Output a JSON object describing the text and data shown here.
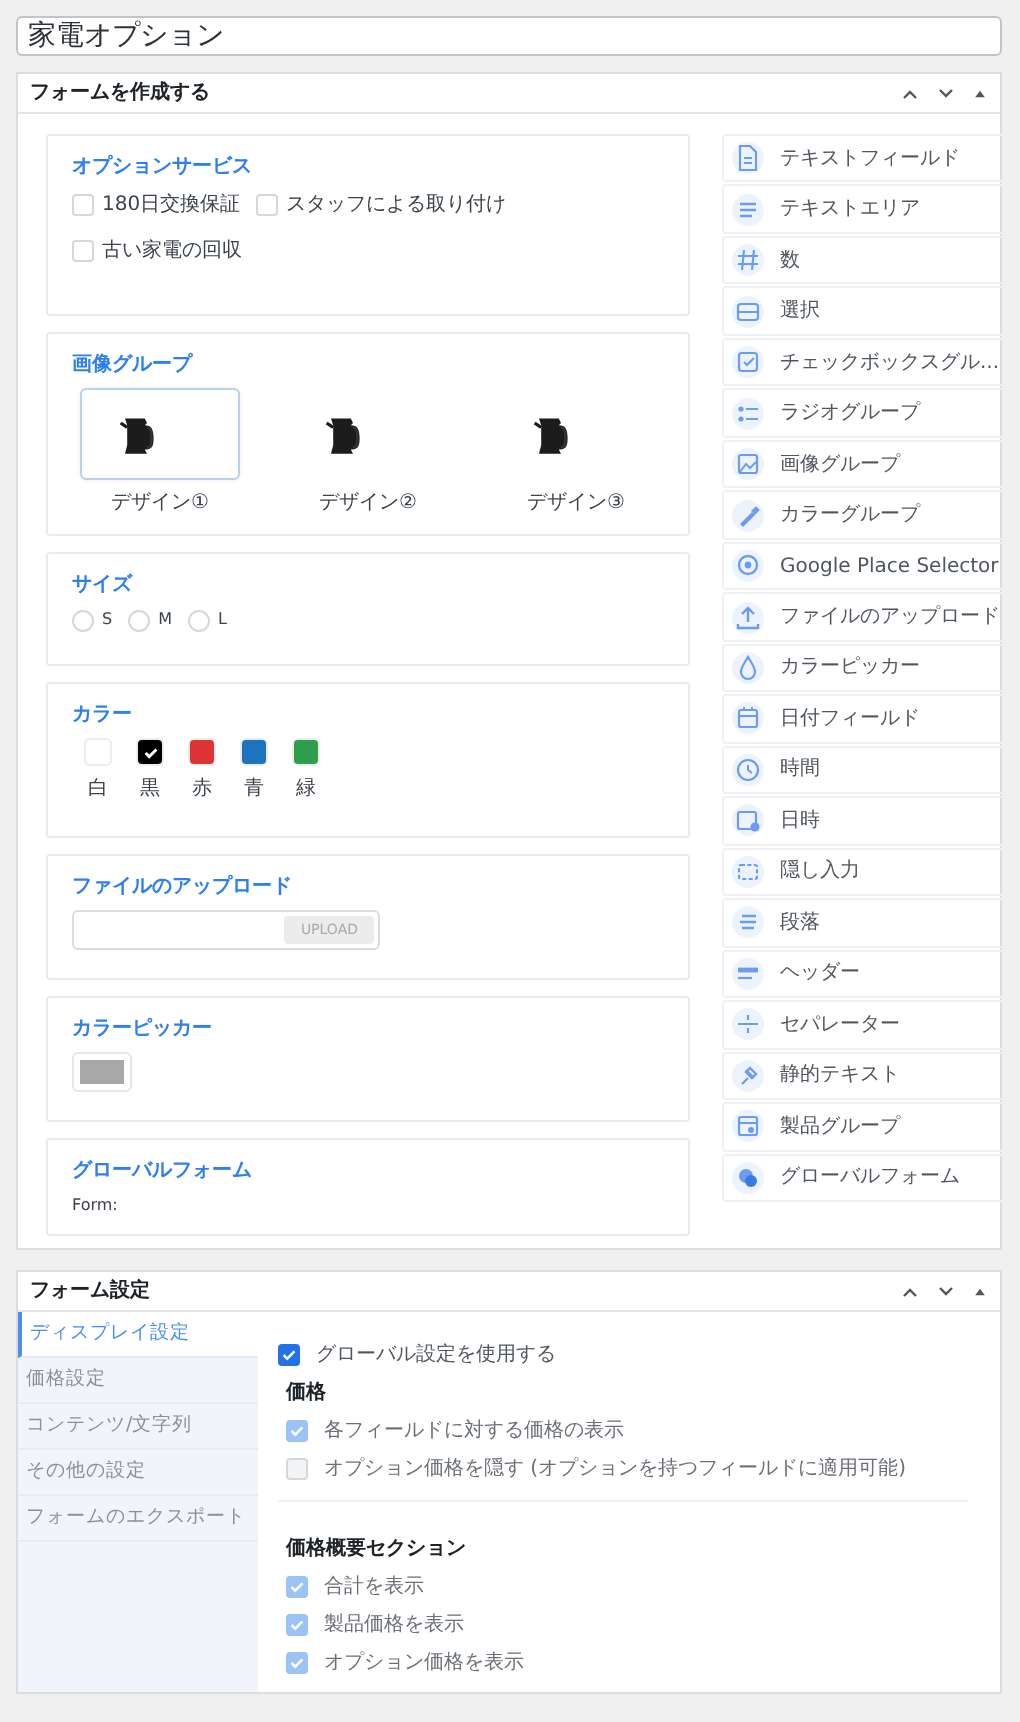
{
  "title_field": {
    "value": "家電オプション"
  },
  "builder": {
    "title": "フォームを作成する",
    "sections": [
      {
        "kind": "checkboxes",
        "label": "オプションサービス",
        "options": [
          {
            "label": "180日交換保証",
            "checked": false
          },
          {
            "label": "スタッフによる取り付け",
            "checked": false
          },
          {
            "label": "古い家電の回収",
            "checked": false
          }
        ]
      },
      {
        "kind": "images",
        "label": "画像グループ",
        "options": [
          {
            "label": "デザイン①",
            "selected": true
          },
          {
            "label": "デザイン②",
            "selected": false
          },
          {
            "label": "デザイン③",
            "selected": false
          }
        ]
      },
      {
        "kind": "radios",
        "label": "サイズ",
        "options": [
          {
            "label": "S",
            "selected": false
          },
          {
            "label": "M",
            "selected": false
          },
          {
            "label": "L",
            "selected": false
          }
        ]
      },
      {
        "kind": "swatches",
        "label": "カラー",
        "options": [
          {
            "label": "白",
            "color": "#ffffff",
            "selected": false
          },
          {
            "label": "黒",
            "color": "#000000",
            "selected": true
          },
          {
            "label": "赤",
            "color": "#dd3333",
            "selected": false
          },
          {
            "label": "青",
            "color": "#1e73be",
            "selected": false
          },
          {
            "label": "緑",
            "color": "#2e9e4a",
            "selected": false
          }
        ]
      },
      {
        "kind": "upload",
        "label": "ファイルのアップロード",
        "button": "UPLOAD"
      },
      {
        "kind": "colorpicker",
        "label": "カラーピッカー"
      },
      {
        "kind": "global",
        "label": "グローバルフォーム",
        "text": "Form:"
      }
    ],
    "fields": [
      {
        "label": "テキストフィールド"
      },
      {
        "label": "テキストエリア"
      },
      {
        "label": "数"
      },
      {
        "label": "選択"
      },
      {
        "label": "チェックボックスグル..."
      },
      {
        "label": "ラジオグループ"
      },
      {
        "label": "画像グループ"
      },
      {
        "label": "カラーグループ"
      },
      {
        "label": "Google Place Selector"
      },
      {
        "label": "ファイルのアップロード"
      },
      {
        "label": "カラーピッカー"
      },
      {
        "label": "日付フィールド"
      },
      {
        "label": "時間"
      },
      {
        "label": "日時"
      },
      {
        "label": "隠し入力"
      },
      {
        "label": "段落"
      },
      {
        "label": "ヘッダー"
      },
      {
        "label": "セパレーター"
      },
      {
        "label": "静的テキスト"
      },
      {
        "label": "製品グループ"
      },
      {
        "label": "グローバルフォーム"
      }
    ]
  },
  "settings": {
    "title": "フォーム設定",
    "tabs": [
      {
        "label": "ディスプレイ設定",
        "selected": true
      },
      {
        "label": "価格設定",
        "selected": false
      },
      {
        "label": "コンテンツ/文字列",
        "selected": false
      },
      {
        "label": "その他の設定",
        "selected": false
      },
      {
        "label": "フォームのエクスポート",
        "selected": false
      }
    ],
    "global": {
      "label": "グローバル設定を使用する",
      "checked": true,
      "disabled": false
    },
    "groups": [
      {
        "heading": "価格",
        "options": [
          {
            "label": "各フィールドに対する価格の表示",
            "checked": true,
            "disabled": true
          },
          {
            "label": "オプション価格を隠す (オプションを持つフィールドに適用可能)",
            "checked": false,
            "disabled": true
          }
        ]
      },
      {
        "heading": "価格概要セクション",
        "options": [
          {
            "label": "合計を表示",
            "checked": true,
            "disabled": true
          },
          {
            "label": "製品価格を表示",
            "checked": true,
            "disabled": true
          },
          {
            "label": "オプション価格を表示",
            "checked": true,
            "disabled": true
          }
        ]
      }
    ]
  }
}
